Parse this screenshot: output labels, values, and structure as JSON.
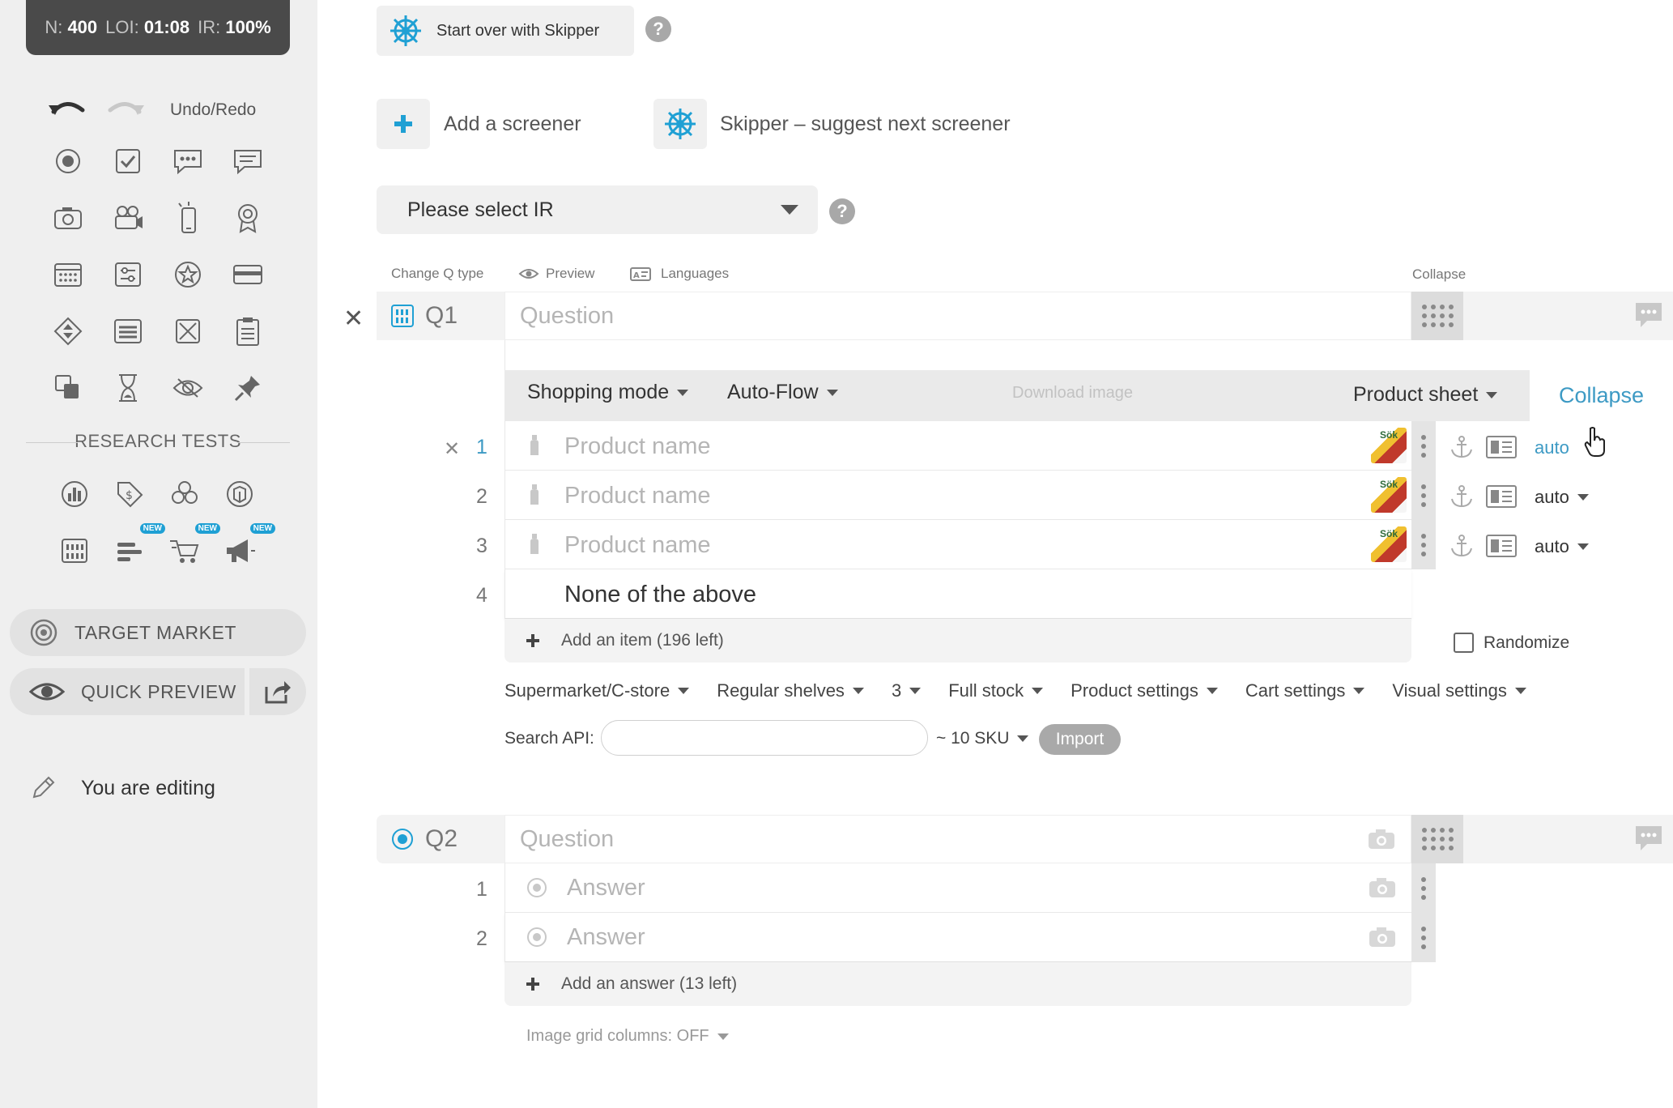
{
  "stats": {
    "n_label": "N:",
    "n_value": "400",
    "loi_label": "LOI:",
    "loi_value": "01:08",
    "ir_label": "IR:",
    "ir_value": "100%"
  },
  "sidebar": {
    "undo_redo_label": "Undo/Redo",
    "research_tests_label": "RESEARCH TESTS",
    "new_badge": "NEW",
    "target_market_label": "TARGET MARKET",
    "quick_preview_label": "QUICK PREVIEW",
    "editing_label": "You are editing"
  },
  "top": {
    "skipper_start_label": "Start over with Skipper",
    "add_screener_label": "Add a screener",
    "skipper_suggest_label": "Skipper – suggest next screener",
    "ir_select_value": "Please select IR"
  },
  "q1": {
    "toolbar": {
      "change_type": "Change Q type",
      "preview": "Preview",
      "languages": "Languages",
      "collapse": "Collapse"
    },
    "number": "Q1",
    "question_placeholder": "Question",
    "modes": {
      "shopping_mode": "Shopping mode",
      "auto_flow": "Auto-Flow",
      "download_image": "Download image",
      "product_sheet": "Product sheet",
      "collapse": "Collapse"
    },
    "items": [
      {
        "num": "1",
        "placeholder": "Product name",
        "thumb_text": "Sök",
        "auto": "auto"
      },
      {
        "num": "2",
        "placeholder": "Product name",
        "thumb_text": "Sök",
        "auto": "auto"
      },
      {
        "num": "3",
        "placeholder": "Product name",
        "thumb_text": "Sök",
        "auto": "auto"
      },
      {
        "num": "4",
        "text": "None of the above"
      }
    ],
    "add_item_label": "Add an item (196 left)",
    "randomize_label": "Randomize",
    "settings": [
      "Supermarket/C-store",
      "Regular shelves",
      "3",
      "Full stock",
      "Product settings",
      "Cart settings",
      "Visual settings"
    ],
    "search_api_label": "Search API:",
    "search_api_value": "",
    "sku_select": "~ 10 SKU",
    "import_label": "Import"
  },
  "q2": {
    "number": "Q2",
    "question_placeholder": "Question",
    "answers": [
      {
        "num": "1",
        "placeholder": "Answer"
      },
      {
        "num": "2",
        "placeholder": "Answer"
      }
    ],
    "add_answer_label": "Add an answer (13 left)",
    "image_grid_label": "Image grid columns: OFF"
  },
  "colors": {
    "accent": "#1fa0d4",
    "sidebar_bg": "#efefef",
    "stats_bg": "#4a4a4a"
  }
}
